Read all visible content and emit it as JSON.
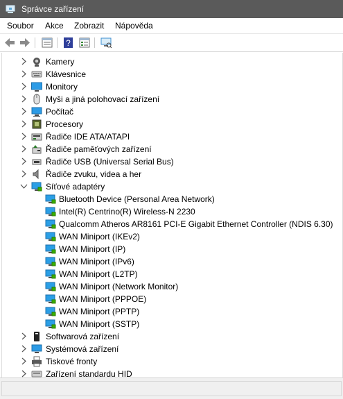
{
  "window": {
    "title": "Správce zařízení",
    "icon": "device-manager-icon"
  },
  "menu": {
    "items": [
      "Soubor",
      "Akce",
      "Zobrazit",
      "Nápověda"
    ]
  },
  "toolbar": {
    "buttons": [
      "back-arrow-icon",
      "forward-arrow-icon",
      "properties-icon",
      "help-icon",
      "details-view-icon",
      "scan-hardware-icon"
    ]
  },
  "tree": {
    "categories_top": [
      {
        "label": "Kamery",
        "icon": "camera-icon"
      },
      {
        "label": "Klávesnice",
        "icon": "keyboard-icon"
      },
      {
        "label": "Monitory",
        "icon": "monitor-icon"
      },
      {
        "label": "Myši a jiná polohovací zařízení",
        "icon": "mouse-icon"
      },
      {
        "label": "Počítač",
        "icon": "computer-icon"
      },
      {
        "label": "Procesory",
        "icon": "processor-icon"
      },
      {
        "label": "Řadiče IDE ATA/ATAPI",
        "icon": "ide-controller-icon"
      },
      {
        "label": "Řadiče paměťových zařízení",
        "icon": "storage-controller-icon"
      },
      {
        "label": "Řadiče USB (Universal Serial Bus)",
        "icon": "usb-icon"
      },
      {
        "label": "Řadiče zvuku, videa a her",
        "icon": "speaker-icon"
      }
    ],
    "expanded": {
      "label": "Síťové adaptéry",
      "icon": "network-adapter-icon",
      "children": [
        "Bluetooth Device (Personal Area Network)",
        "Intel(R) Centrino(R) Wireless-N 2230",
        "Qualcomm Atheros AR8161 PCI-E Gigabit Ethernet Controller (NDIS 6.30)",
        "WAN Miniport (IKEv2)",
        "WAN Miniport (IP)",
        "WAN Miniport (IPv6)",
        "WAN Miniport (L2TP)",
        "WAN Miniport (Network Monitor)",
        "WAN Miniport (PPPOE)",
        "WAN Miniport (PPTP)",
        "WAN Miniport (SSTP)"
      ]
    },
    "categories_bottom": [
      {
        "label": "Softwarová zařízení",
        "icon": "software-device-icon"
      },
      {
        "label": "Systémová zařízení",
        "icon": "system-device-icon"
      },
      {
        "label": "Tiskové fronty",
        "icon": "printer-icon"
      },
      {
        "label": "Zařízení standardu HID",
        "icon": "hid-icon"
      }
    ]
  },
  "colors": {
    "titlebar": "#5a5a5a",
    "accent_blue": "#1e8fd6",
    "network_icon": "#2b9fe6"
  }
}
